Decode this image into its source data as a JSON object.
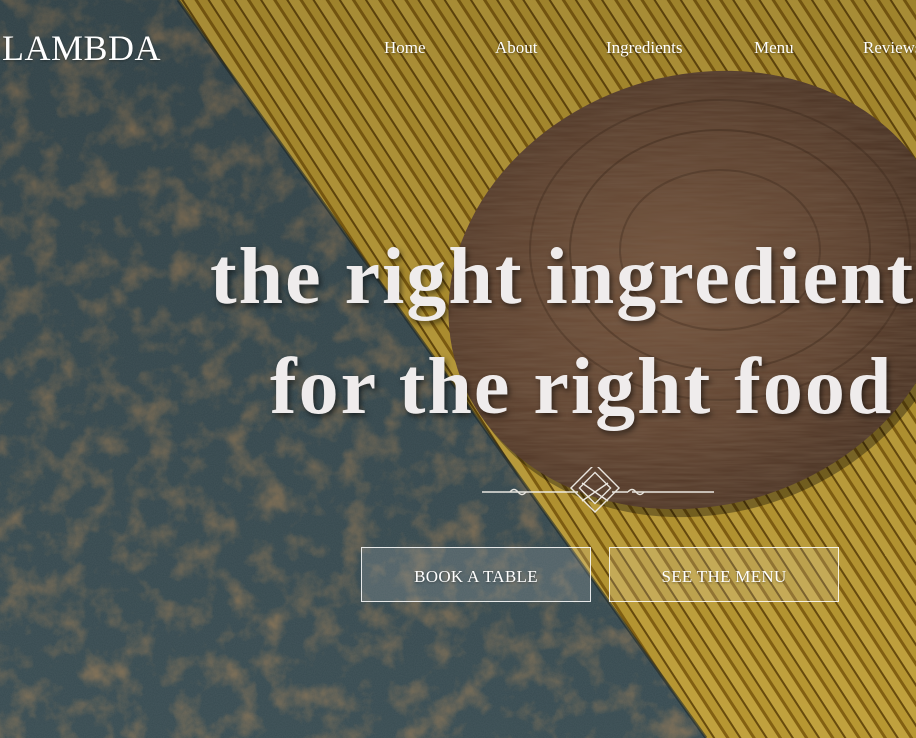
{
  "brand": {
    "name": "LAMBDA"
  },
  "nav": {
    "items": [
      {
        "label": "Home"
      },
      {
        "label": "About"
      },
      {
        "label": "Ingredients"
      },
      {
        "label": "Menu"
      },
      {
        "label": "Reviews"
      }
    ]
  },
  "hero": {
    "line1": "the right ingredients",
    "line2": "for the right food"
  },
  "actions": {
    "book_label": "BOOK A TABLE",
    "menu_label": "SEE THE MENU"
  },
  "colors": {
    "rust_metal": "#3f545a",
    "rust": "#7a4a22",
    "pasta": "#d9b43a",
    "wood": "#6b4a35",
    "text": "#ffffff"
  }
}
